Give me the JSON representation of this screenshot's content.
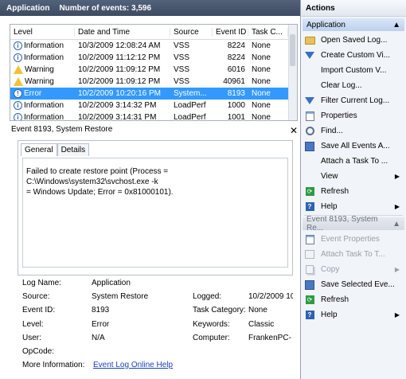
{
  "log": {
    "title": "Application",
    "event_count": "Number of events: 3,596"
  },
  "table": {
    "headers": [
      "Level",
      "Date and Time",
      "Source",
      "Event ID",
      "Task C..."
    ],
    "rows": [
      {
        "level": "Information",
        "date": "10/3/2009 12:08:24 AM",
        "source": "VSS",
        "id": "8224",
        "task": "None",
        "icon": "info-icon"
      },
      {
        "level": "Information",
        "date": "10/2/2009 11:12:12 PM",
        "source": "VSS",
        "id": "8224",
        "task": "None",
        "icon": "info-icon"
      },
      {
        "level": "Warning",
        "date": "10/2/2009 11:09:12 PM",
        "source": "VSS",
        "id": "6016",
        "task": "None",
        "icon": "warning-icon"
      },
      {
        "level": "Warning",
        "date": "10/2/2009 11:09:12 PM",
        "source": "VSS",
        "id": "40961",
        "task": "None",
        "icon": "warning-icon"
      },
      {
        "level": "Error",
        "date": "10/2/2009 10:20:16 PM",
        "source": "System...",
        "id": "8193",
        "task": "None",
        "icon": "error-icon",
        "selected": true
      },
      {
        "level": "Information",
        "date": "10/2/2009 3:14:32 PM",
        "source": "LoadPerf",
        "id": "1000",
        "task": "None",
        "icon": "info-icon"
      },
      {
        "level": "Information",
        "date": "10/2/2009 3:14:31 PM",
        "source": "LoadPerf",
        "id": "1001",
        "task": "None",
        "icon": "info-icon"
      }
    ]
  },
  "detail": {
    "title": "Event 8193, System Restore",
    "tabs": [
      "General",
      "Details"
    ],
    "message_line1": "Failed to create restore point (Process = C:\\Windows\\system32\\svchost.exe -k",
    "message_line2": "= Windows Update; Error = 0x81000101).",
    "props": {
      "log_name_label": "Log Name:",
      "log_name": "Application",
      "source_label": "Source:",
      "source": "System Restore",
      "logged_label": "Logged:",
      "logged": "10/2/2009 10",
      "event_id_label": "Event ID:",
      "event_id": "8193",
      "task_category_label": "Task Category:",
      "task_category": "None",
      "level_label": "Level:",
      "level": "Error",
      "keywords_label": "Keywords:",
      "keywords": "Classic",
      "user_label": "User:",
      "user": "N/A",
      "computer_label": "Computer:",
      "computer": "FrankenPC-",
      "opcode_label": "OpCode:",
      "more_info_label": "More Information:",
      "more_info_link": "Event Log Online Help"
    }
  },
  "actions": {
    "title": "Actions",
    "section1": "Application",
    "items1": [
      {
        "label": "Open Saved Log...",
        "icon": "folder-icon"
      },
      {
        "label": "Create Custom Vi...",
        "icon": "filter-icon"
      },
      {
        "label": "Import Custom V...",
        "icon": ""
      },
      {
        "label": "Clear Log...",
        "icon": ""
      },
      {
        "label": "Filter Current Log...",
        "icon": "filter-icon"
      },
      {
        "label": "Properties",
        "icon": "properties-icon"
      },
      {
        "label": "Find...",
        "icon": "find-icon"
      },
      {
        "label": "Save All Events A...",
        "icon": "save-icon"
      },
      {
        "label": "Attach a Task To ...",
        "icon": ""
      },
      {
        "label": "View",
        "icon": "",
        "submenu": true
      },
      {
        "label": "Refresh",
        "icon": "refresh-icon"
      },
      {
        "label": "Help",
        "icon": "help-icon",
        "submenu": true
      }
    ],
    "section2": "Event 8193, System Re...",
    "items2": [
      {
        "label": "Event Properties",
        "icon": "properties-icon",
        "disabled": true
      },
      {
        "label": "Attach Task To T...",
        "icon": "task-icon",
        "disabled": true
      },
      {
        "label": "Copy",
        "icon": "copy-icon",
        "disabled": true,
        "submenu": true
      },
      {
        "label": "Save Selected Eve...",
        "icon": "save-icon"
      },
      {
        "label": "Refresh",
        "icon": "refresh-icon"
      },
      {
        "label": "Help",
        "icon": "help-icon",
        "submenu": true
      }
    ]
  }
}
